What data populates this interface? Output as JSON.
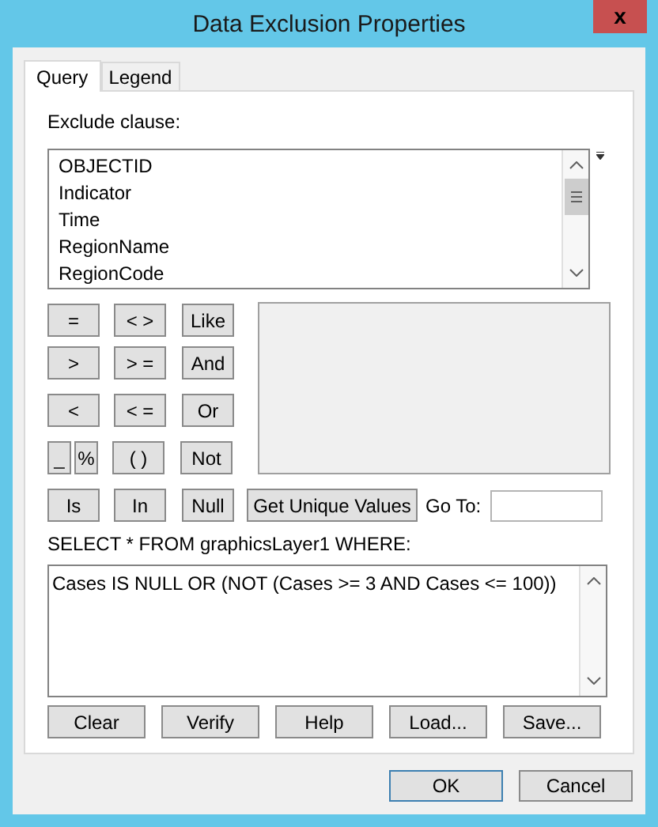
{
  "window": {
    "title": "Data Exclusion Properties",
    "close": "x"
  },
  "tabs": [
    {
      "label": "Query",
      "selected": true
    },
    {
      "label": "Legend",
      "selected": false
    }
  ],
  "exclude_label": "Exclude clause:",
  "fields": [
    "OBJECTID",
    "Indicator",
    "Time",
    "RegionName",
    "RegionCode"
  ],
  "operator_rows": [
    [
      "=",
      "< >",
      "Like"
    ],
    [
      ">",
      "> =",
      "And"
    ],
    [
      "<",
      "< =",
      "Or"
    ],
    [
      "_",
      "%",
      "( )",
      "Not"
    ],
    [
      "Is",
      "In",
      "Null"
    ]
  ],
  "get_unique_values": "Get Unique Values",
  "goto": {
    "label": "Go To:"
  },
  "select_label": "SELECT * FROM graphicsLayer1 WHERE:",
  "expression": "Cases IS NULL OR (NOT (Cases >= 3 AND Cases <= 100))",
  "actions": [
    "Clear",
    "Verify",
    "Help",
    "Load...",
    "Save..."
  ],
  "dialog_buttons": [
    {
      "label": "OK",
      "default": true
    },
    {
      "label": "Cancel",
      "default": false
    }
  ]
}
